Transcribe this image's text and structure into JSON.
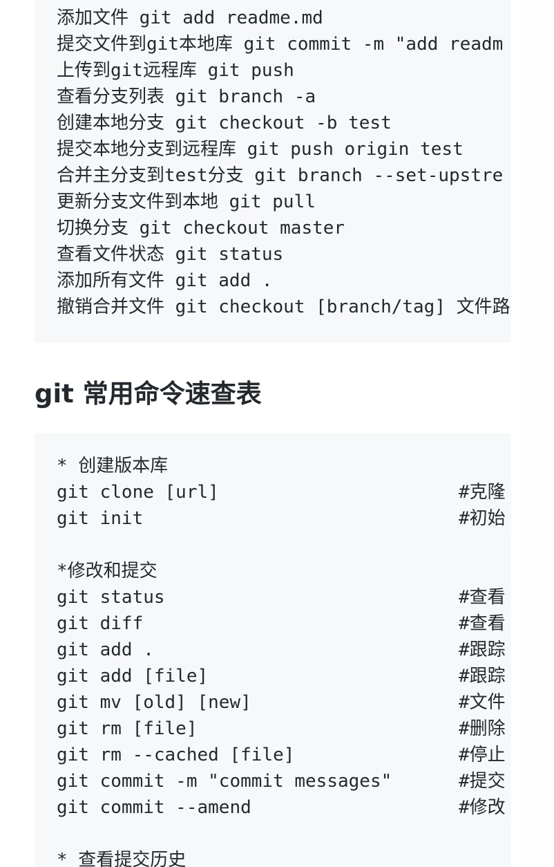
{
  "block1": {
    "lines": [
      "添加文件 git add readme.md",
      "提交文件到git本地库 git commit -m \"add readm",
      "上传到git远程库 git push",
      "查看分支列表 git branch -a",
      "创建本地分支 git checkout -b test",
      "提交本地分支到远程库 git push origin test",
      "合并主分支到test分支 git branch --set-upstre",
      "更新分支文件到本地 git pull",
      "切换分支 git checkout master",
      "查看文件状态 git status",
      "添加所有文件 git add .",
      "撤销合并文件 git checkout [branch/tag] 文件路"
    ]
  },
  "heading": "git 常用命令速查表",
  "block2": {
    "rows": [
      {
        "cmd": "* 创建版本库",
        "comment": ""
      },
      {
        "cmd": "git clone [url]",
        "comment": "#克隆"
      },
      {
        "cmd": "git init",
        "comment": "#初始"
      },
      {
        "cmd": "",
        "comment": ""
      },
      {
        "cmd": "*修改和提交",
        "comment": ""
      },
      {
        "cmd": "git status",
        "comment": "#查看"
      },
      {
        "cmd": "git diff",
        "comment": "#查看"
      },
      {
        "cmd": "git add .",
        "comment": "#跟踪"
      },
      {
        "cmd": "git add [file]",
        "comment": "#跟踪"
      },
      {
        "cmd": "git mv [old] [new]",
        "comment": "#文件"
      },
      {
        "cmd": "git rm [file]",
        "comment": "#删除"
      },
      {
        "cmd": "git rm --cached [file]",
        "comment": "#停止"
      },
      {
        "cmd": "git commit -m \"commit messages\"",
        "comment": "#提交"
      },
      {
        "cmd": "git commit --amend",
        "comment": "#修改"
      },
      {
        "cmd": "",
        "comment": ""
      },
      {
        "cmd": "* 查看提交历史",
        "comment": ""
      }
    ]
  }
}
